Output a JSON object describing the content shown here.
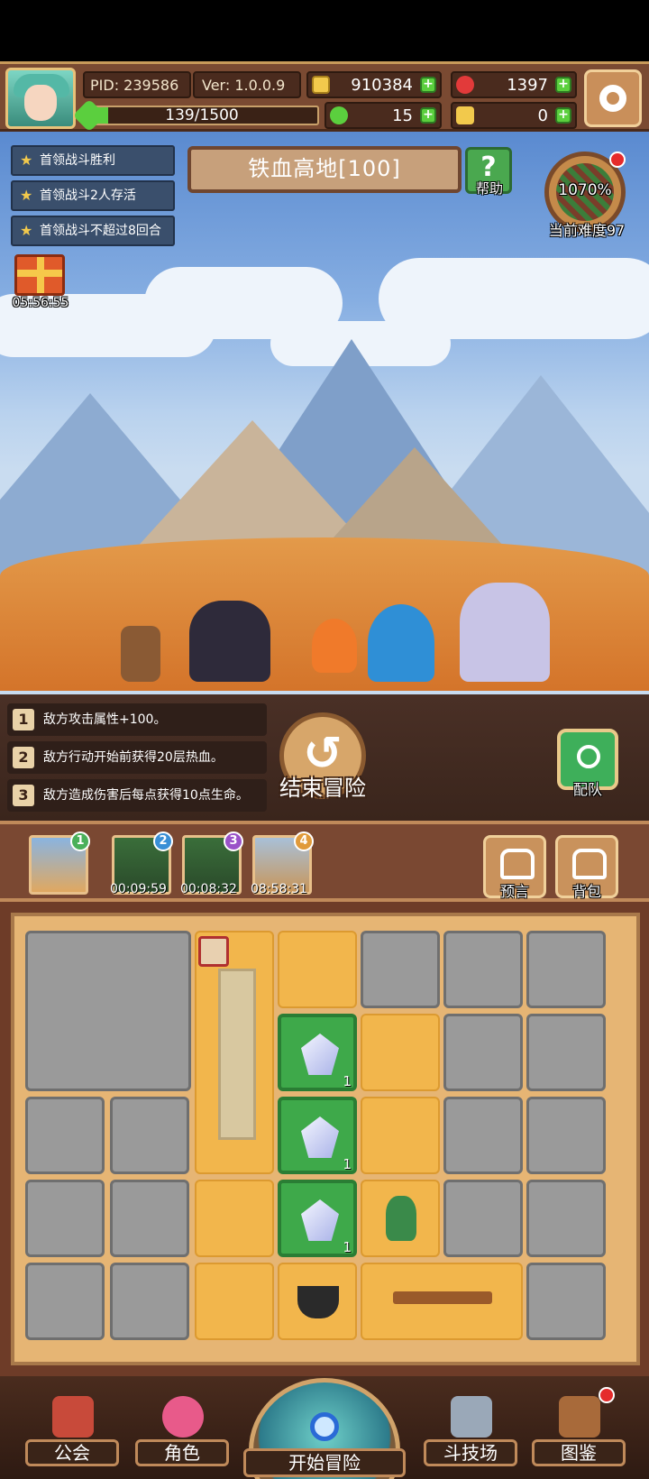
{
  "player": {
    "pid": "PID: 239586",
    "version": "Ver: 1.0.0.9",
    "gold": "910384",
    "gems": "1397",
    "stamina": "139/1500",
    "stamina_fraction": 0.093,
    "clover": "15",
    "keys": "0"
  },
  "quests": [
    {
      "label": "首领战斗胜利"
    },
    {
      "label": "首领战斗2人存活"
    },
    {
      "label": "首领战斗不超过8回合"
    }
  ],
  "stage": {
    "title": "铁血高地[100]",
    "help_label": "帮助",
    "difficulty_percent": "1070%",
    "difficulty_label": "当前难度97"
  },
  "gift_timer": "05:56:55",
  "modifiers": [
    {
      "num": "1",
      "text": "敌方攻击属性+100。"
    },
    {
      "num": "2",
      "text": "敌方行动开始前获得20层热血。"
    },
    {
      "num": "3",
      "text": "敌方造成伤害后每点获得10点生命。"
    }
  ],
  "end_adventure_label": "结束冒险",
  "team_label": "配队",
  "stages_row": [
    {
      "badge": "1",
      "timer": ""
    },
    {
      "badge": "2",
      "timer": "00:09:59"
    },
    {
      "badge": "3",
      "timer": "00:08:32"
    },
    {
      "badge": "4",
      "timer": "08:58:31"
    }
  ],
  "prophecy_label": "预言",
  "backpack_label": "背包",
  "grid_gem_count": "1",
  "nav": {
    "guild": "公会",
    "character": "角色",
    "start": "开始冒险",
    "arena": "斗技场",
    "codex": "图鉴"
  },
  "colors": {
    "accent_green": "#5bcf3e",
    "sand": "#f2b64c",
    "stone": "#9a9a9a",
    "panel_brown": "#7a4a32"
  }
}
